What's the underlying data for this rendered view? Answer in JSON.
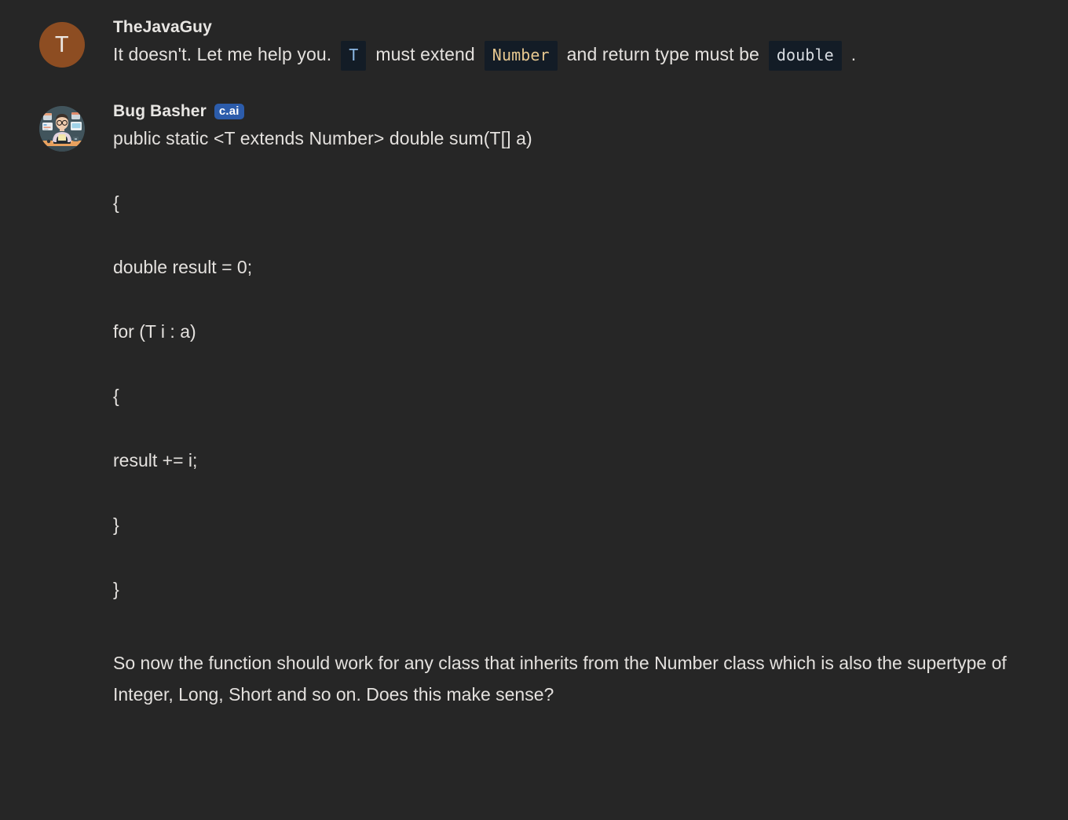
{
  "theme": {
    "background": "#262626",
    "text": "#e4e1de",
    "code_chip_bg": "#131c26",
    "code_chip_type": "#8cb8e4",
    "code_chip_class": "#e7c890",
    "code_chip_keyword": "#d9dde2",
    "badge_bg": "#2c5cab",
    "avatar_user_bg": "#8d4d22"
  },
  "messages": [
    {
      "author": "TheJavaGuy",
      "avatar_type": "letter",
      "avatar_letter": "T",
      "badge": null,
      "text_segments": [
        {
          "kind": "text",
          "value": "It doesn't. Let me help you."
        },
        {
          "kind": "code",
          "value": "T",
          "style": "type"
        },
        {
          "kind": "text",
          "value": "must extend"
        },
        {
          "kind": "code",
          "value": "Number",
          "style": "class"
        },
        {
          "kind": "text",
          "value": "and return type must be"
        },
        {
          "kind": "code",
          "value": "double",
          "style": "keyword"
        },
        {
          "kind": "text",
          "value": "."
        }
      ]
    },
    {
      "author": "Bug Basher",
      "avatar_type": "illustration",
      "avatar_letter": null,
      "badge": "c.ai",
      "first_line": "public static <T extends Number> double sum(T[] a)",
      "code_lines": [
        "{",
        "double result = 0;",
        "for (T i : a)",
        "{",
        "result += i;",
        "}",
        "}"
      ],
      "closing_paragraph": "So now the function should work for any class that inherits from the Number class which is also the supertype of Integer, Long, Short and so on. Does this make sense?"
    }
  ]
}
